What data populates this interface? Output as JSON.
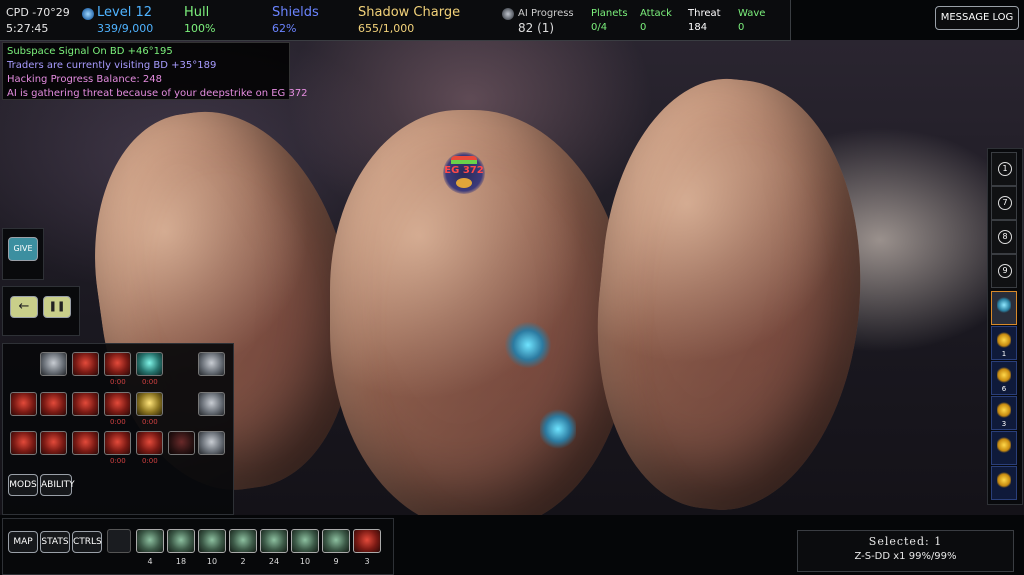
{
  "topbar": {
    "location": "CPD -70°29",
    "clock": "5:27:45",
    "level": {
      "label": "Level 12",
      "value": "339/9,000"
    },
    "hull": {
      "label": "Hull",
      "value": "100%"
    },
    "shields": {
      "label": "Shields",
      "value": "62%"
    },
    "shadow_charge": {
      "label": "Shadow Charge",
      "value": "655/1,000"
    },
    "ai_progress": {
      "label": "AI Progress",
      "value": "82 (1)"
    },
    "planets": {
      "label": "Planets",
      "value": "0/4"
    },
    "attack": {
      "label": "Attack",
      "value": "0"
    },
    "threat": {
      "label": "Threat",
      "value": "184"
    },
    "wave": {
      "label": "Wave",
      "value": "0"
    },
    "message_log": "MESSAGE LOG"
  },
  "events": [
    {
      "text": "Subspace Signal On BD +46°195",
      "color": "#7cf07c"
    },
    {
      "text": "Traders are currently visiting BD +35°189",
      "color": "#a89cff"
    },
    {
      "text": "Hacking Progress Balance: 248",
      "color": "#e58de0"
    },
    {
      "text": "AI is gathering threat because of your deepstrike on EG 372",
      "color": "#e58de0"
    }
  ],
  "planet_label": "EG 372",
  "side": {
    "give": "GIVE",
    "mods": "MODS",
    "ability": "ABILITY"
  },
  "build_grid": {
    "rows": [
      {
        "tiles": [
          "gray",
          "red",
          "red",
          "teal"
        ],
        "counts": [
          "",
          "",
          "0:00",
          "0:00"
        ],
        "extra": "gray"
      },
      {
        "tiles": [
          "red",
          "red",
          "red",
          "red",
          "yellow"
        ],
        "counts": [
          "",
          "",
          "",
          "0:00",
          "0:00"
        ],
        "extra": "gray"
      },
      {
        "tiles": [
          "red",
          "red",
          "red",
          "red",
          "red",
          "dark"
        ],
        "counts": [
          "",
          "",
          "",
          "0:00",
          "0:00",
          ""
        ],
        "extra": "gray"
      }
    ]
  },
  "bottom": {
    "map": "MAP",
    "stats": "STATS",
    "ctrls": "CTRLS",
    "ship_counts": [
      "4",
      "18",
      "10",
      "2",
      "24",
      "10",
      "9",
      "3"
    ],
    "selected_title": "Selected: 1",
    "selected_detail": "Z-S-DD x1 99%/99%"
  },
  "right_rail": {
    "control_groups": [
      "1",
      "7",
      "8",
      "9"
    ],
    "ship_counts": [
      "",
      "1",
      "6",
      "3",
      "",
      ""
    ]
  },
  "colors": {
    "level": "#4fb3ff",
    "hull": "#7cf07c",
    "shields": "#6b84ff",
    "shadow": "#f2d27a",
    "planets": "#7cf07c",
    "attack": "#7cf07c",
    "wave": "#7cf07c"
  }
}
